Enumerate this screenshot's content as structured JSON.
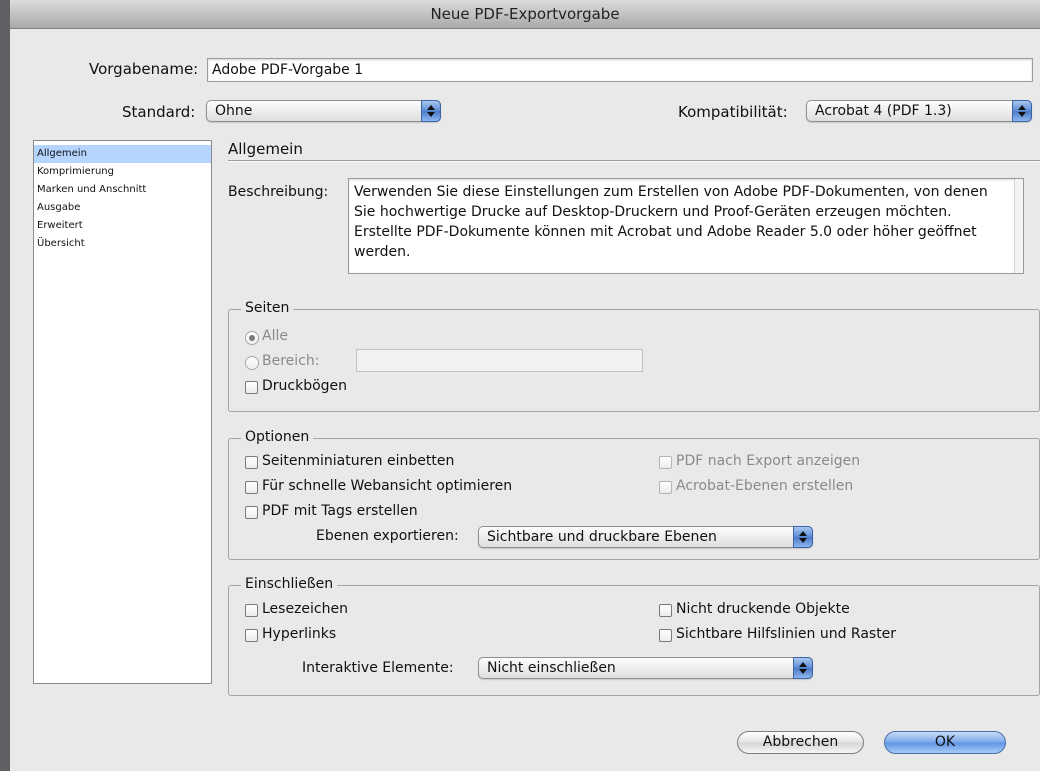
{
  "window": {
    "title": "Neue PDF-Exportvorgabe"
  },
  "header": {
    "preset_label": "Vorgabename:",
    "preset_value": "Adobe PDF-Vorgabe 1",
    "standard_label": "Standard:",
    "standard_value": "Ohne",
    "compat_label": "Kompatibilität:",
    "compat_value": "Acrobat 4 (PDF 1.3)"
  },
  "sidebar": {
    "items": [
      {
        "label": "Allgemein",
        "selected": true
      },
      {
        "label": "Komprimierung"
      },
      {
        "label": "Marken und Anschnitt"
      },
      {
        "label": "Ausgabe"
      },
      {
        "label": "Erweitert"
      },
      {
        "label": "Übersicht"
      }
    ]
  },
  "main": {
    "section_title": "Allgemein",
    "description_label": "Beschreibung:",
    "description_text": "Verwenden Sie diese Einstellungen zum Erstellen von Adobe PDF-Dokumenten, von denen Sie hochwertige Drucke auf Desktop-Druckern und Proof-Geräten erzeugen möchten. Erstellte PDF-Dokumente können mit Acrobat und Adobe Reader 5.0 oder höher geöffnet werden.",
    "seiten": {
      "title": "Seiten",
      "all_label": "Alle",
      "range_label": "Bereich:",
      "range_value": "",
      "spreads_label": "Druckbögen"
    },
    "optionen": {
      "title": "Optionen",
      "thumbnails": "Seitenminiaturen einbetten",
      "web_optimize": "Für schnelle Webansicht optimieren",
      "tagged_pdf": "PDF mit Tags erstellen",
      "view_after_export": "PDF nach Export anzeigen",
      "acrobat_layers": "Acrobat-Ebenen erstellen",
      "export_layers_label": "Ebenen exportieren:",
      "export_layers_value": "Sichtbare und druckbare Ebenen"
    },
    "einschliessen": {
      "title": "Einschließen",
      "bookmarks": "Lesezeichen",
      "hyperlinks": "Hyperlinks",
      "non_printing": "Nicht druckende Objekte",
      "guides_grids": "Sichtbare Hilfslinien und Raster",
      "interactive_label": "Interaktive Elemente:",
      "interactive_value": "Nicht einschließen"
    }
  },
  "footer": {
    "cancel_label": "Abbrechen",
    "ok_label": "OK"
  }
}
